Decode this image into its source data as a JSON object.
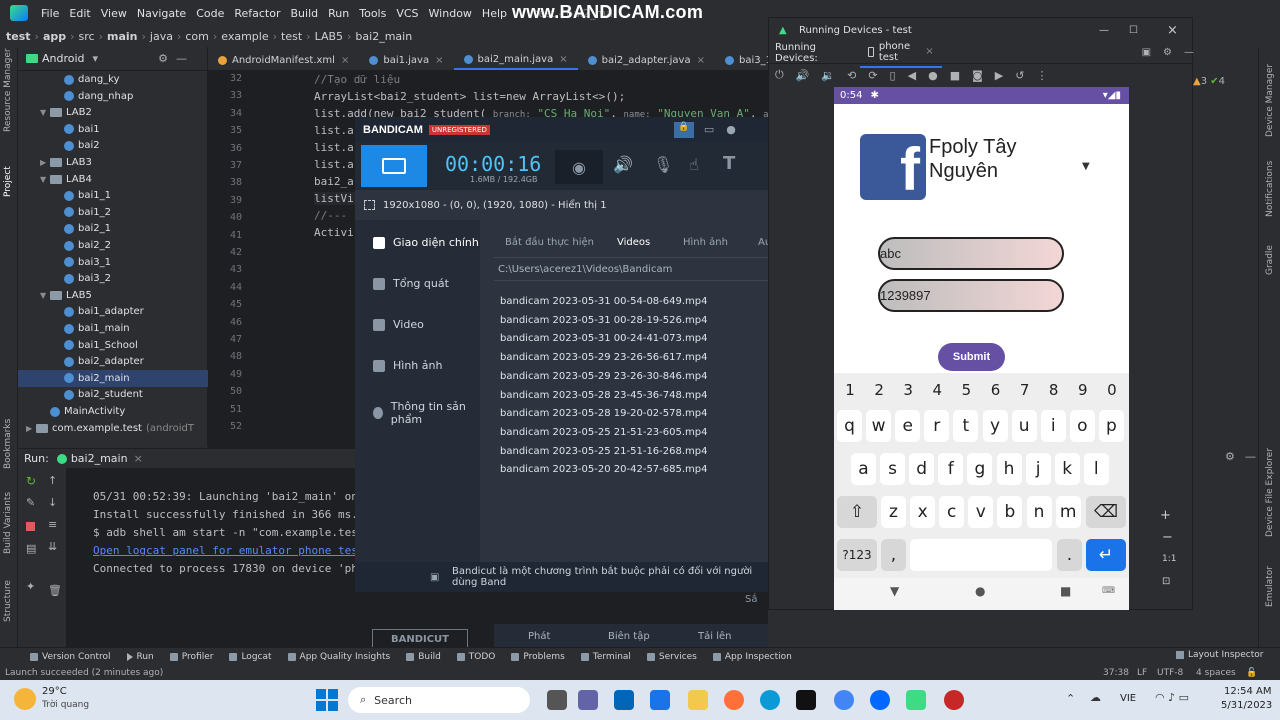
{
  "menubar": {
    "items": [
      "File",
      "Edit",
      "View",
      "Navigate",
      "Code",
      "Refactor",
      "Build",
      "Run",
      "Tools",
      "VCS",
      "Window",
      "Help"
    ],
    "window_title": "test - bai2_mai",
    "watermark": "www.BANDICAM.com"
  },
  "breadcrumb": [
    "test",
    "app",
    "src",
    "main",
    "java",
    "com",
    "example",
    "test",
    "LAB5",
    "bai2_main"
  ],
  "project": {
    "selector": "Android",
    "items": [
      {
        "label": "dang_ky",
        "kind": "class",
        "indent": 3
      },
      {
        "label": "dang_nhap",
        "kind": "class",
        "indent": 3
      },
      {
        "label": "LAB2",
        "kind": "folder",
        "indent": 2,
        "open": true
      },
      {
        "label": "bai1",
        "kind": "class",
        "indent": 3
      },
      {
        "label": "bai2",
        "kind": "class",
        "indent": 3
      },
      {
        "label": "LAB3",
        "kind": "folder",
        "indent": 2,
        "open": false
      },
      {
        "label": "LAB4",
        "kind": "folder",
        "indent": 2,
        "open": true
      },
      {
        "label": "bai1_1",
        "kind": "class",
        "indent": 3
      },
      {
        "label": "bai1_2",
        "kind": "class",
        "indent": 3
      },
      {
        "label": "bai2_1",
        "kind": "class",
        "indent": 3
      },
      {
        "label": "bai2_2",
        "kind": "class",
        "indent": 3
      },
      {
        "label": "bai3_1",
        "kind": "class",
        "indent": 3
      },
      {
        "label": "bai3_2",
        "kind": "class",
        "indent": 3
      },
      {
        "label": "LAB5",
        "kind": "folder",
        "indent": 2,
        "open": true
      },
      {
        "label": "bai1_adapter",
        "kind": "class",
        "indent": 3
      },
      {
        "label": "bai1_main",
        "kind": "class",
        "indent": 3
      },
      {
        "label": "bai1_School",
        "kind": "class",
        "indent": 3
      },
      {
        "label": "bai2_adapter",
        "kind": "class",
        "indent": 3
      },
      {
        "label": "bai2_main",
        "kind": "class",
        "indent": 3,
        "selected": true
      },
      {
        "label": "bai2_student",
        "kind": "class",
        "indent": 3
      },
      {
        "label": "MainActivity",
        "kind": "class",
        "indent": 2
      },
      {
        "label": "com.example.test",
        "kind": "folder",
        "indent": 1,
        "open": false,
        "suffix": "(androidT"
      }
    ]
  },
  "editor_tabs": [
    {
      "label": "AndroidManifest.xml",
      "active": false
    },
    {
      "label": "bai1.java",
      "active": false
    },
    {
      "label": "bai2_main.java",
      "active": true
    },
    {
      "label": "bai2_adapter.java",
      "active": false
    },
    {
      "label": "bai3_1.java",
      "active": false
    }
  ],
  "editor": {
    "line_numbers": [
      "32",
      "33",
      "34",
      "35",
      "36",
      "37",
      "38",
      "39",
      "40",
      "41",
      "42",
      "43",
      "44",
      "45",
      "46",
      "47",
      "48",
      "49",
      "50",
      "51",
      "52"
    ],
    "code": {
      "l32": "//Tạo dữ liệu",
      "l33": "ArrayList<bai2_student> list=new ArrayList<>();",
      "l34a": "list.add(new bai2_student(",
      "l34hint1": "branch:",
      "l34str1": "\"CS Ha Noi\"",
      "l34hint2": "name:",
      "l34str2": "\"Nguyen Van A\"",
      "l34hint3": "ad",
      "l35": "list.a",
      "l36": "list.a",
      "l37": "list.a",
      "l38": "bai2_a",
      "l39": "listVi",
      "l40": "//---",
      "l41": "Activi"
    }
  },
  "run": {
    "tab_label": "Run:",
    "config": "bai2_main",
    "lines": [
      "05/31 00:52:39: Launching 'bai2_main' on p",
      "Install successfully finished in 366 ms.",
      "$ adb shell am start -n \"com.example.test/",
      "Open logcat panel for emulator phone test",
      "Connected to process 17830 on device 'phon"
    ]
  },
  "bandicam": {
    "logo": "BANDICAM",
    "unregistered": "UNREGISTERED",
    "timer": "00:00:16",
    "size": "1.6MB / 192.4GB",
    "resolution": "1920x1080 - (0, 0), (1920, 1080) - Hiển thị 1",
    "menu": [
      "Giao diện chính",
      "Tổng quát",
      "Video",
      "Hình ảnh",
      "Thông tin sản phẩm"
    ],
    "tabs": [
      "Bắt đầu thực hiện",
      "Videos",
      "Hình ảnh",
      "Au"
    ],
    "path": "C:\\Users\\acerez1\\Videos\\Bandicam",
    "files": [
      "bandicam 2023-05-31 00-54-08-649.mp4",
      "bandicam 2023-05-31 00-28-19-526.mp4",
      "bandicam 2023-05-31 00-24-41-073.mp4",
      "bandicam 2023-05-29 23-26-56-617.mp4",
      "bandicam 2023-05-29 23-26-30-846.mp4",
      "bandicam 2023-05-28 23-45-36-748.mp4",
      "bandicam 2023-05-28 19-20-02-578.mp4",
      "bandicam 2023-05-25 21-51-23-605.mp4",
      "bandicam 2023-05-25 21-51-16-268.mp4",
      "bandicam 2023-05-20 20-42-57-685.mp4"
    ],
    "sort_label": "Sắ",
    "bandicut": "BANDICUT",
    "actions": [
      "Phát",
      "Biên tập",
      "Tải lên"
    ],
    "footer": "Bandicut là một chương trình bắt buộc phải có đối với người dùng Band"
  },
  "devices": {
    "title": "Running Devices - test",
    "tab_prefix": "Running Devices:",
    "tab": "phone test"
  },
  "phone": {
    "time": "0:54",
    "logo_letter": "f",
    "title": "Fpoly Tây Nguyên",
    "input1": "abc",
    "input2": "1239897",
    "submit": "Submit",
    "num_row": [
      "1",
      "2",
      "3",
      "4",
      "5",
      "6",
      "7",
      "8",
      "9",
      "0"
    ],
    "row1": [
      "q",
      "w",
      "e",
      "r",
      "t",
      "y",
      "u",
      "i",
      "o",
      "p"
    ],
    "row2": [
      "a",
      "s",
      "d",
      "f",
      "g",
      "h",
      "j",
      "k",
      "l"
    ],
    "row3": [
      "z",
      "x",
      "c",
      "v",
      "b",
      "n",
      "m"
    ],
    "sym_key": "?123",
    "comma": ",",
    "period": "."
  },
  "left_strip": [
    "Resource Manager",
    "Project",
    "Bookmarks",
    "Build Variants",
    "Structure"
  ],
  "right_strip": [
    "Device Manager",
    "Notifications",
    "Gradle",
    "Device File Explorer",
    "Emulator"
  ],
  "bottom_tools": [
    "Version Control",
    "Run",
    "Profiler",
    "Logcat",
    "App Quality Insights",
    "Build",
    "TODO",
    "Problems",
    "Terminal",
    "Services",
    "App Inspection"
  ],
  "layout_inspector": "Layout Inspector",
  "status": {
    "message": "Launch succeeded (2 minutes ago)",
    "position": "37:38",
    "line_sep": "LF",
    "encoding": "UTF-8",
    "indent": "4 spaces"
  },
  "taskbar": {
    "temp": "29°C",
    "weather": "Trời quang",
    "search": "Search",
    "lang": "VIE",
    "time": "12:54 AM",
    "date": "5/31/2023"
  }
}
